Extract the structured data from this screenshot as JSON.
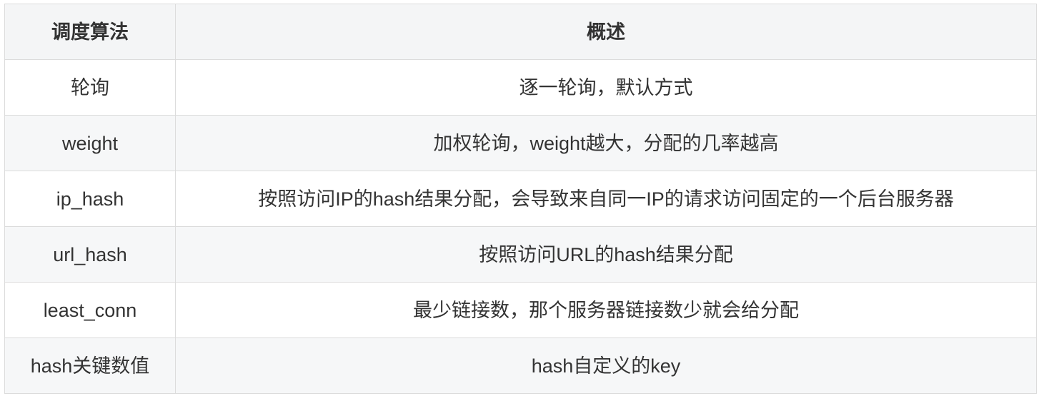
{
  "table": {
    "headers": [
      "调度算法",
      "概述"
    ],
    "rows": [
      {
        "algorithm": "轮询",
        "description": "逐一轮询，默认方式"
      },
      {
        "algorithm": "weight",
        "description": "加权轮询，weight越大，分配的几率越高"
      },
      {
        "algorithm": "ip_hash",
        "description": "按照访问IP的hash结果分配，会导致来自同一IP的请求访问固定的一个后台服务器"
      },
      {
        "algorithm": "url_hash",
        "description": "按照访问URL的hash结果分配"
      },
      {
        "algorithm": "least_conn",
        "description": "最少链接数，那个服务器链接数少就会给分配"
      },
      {
        "algorithm": "hash关键数值",
        "description": "hash自定义的key"
      }
    ]
  }
}
